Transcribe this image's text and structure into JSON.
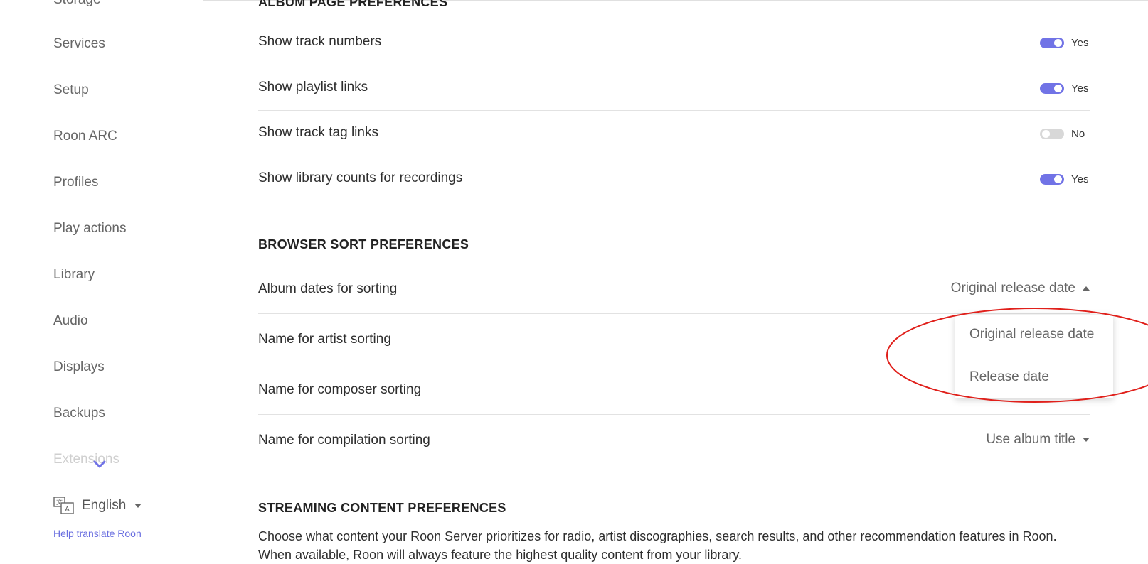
{
  "sidebar": {
    "items": [
      {
        "label": "Storage"
      },
      {
        "label": "Services"
      },
      {
        "label": "Setup"
      },
      {
        "label": "Roon ARC"
      },
      {
        "label": "Profiles"
      },
      {
        "label": "Play actions"
      },
      {
        "label": "Library"
      },
      {
        "label": "Audio"
      },
      {
        "label": "Displays"
      },
      {
        "label": "Backups"
      },
      {
        "label": "Extensions"
      }
    ],
    "language": "English",
    "help_link": "Help translate Roon"
  },
  "album_page": {
    "title": "ALBUM PAGE PREFERENCES",
    "rows": [
      {
        "label": "Show track numbers",
        "value": "Yes",
        "on": true
      },
      {
        "label": "Show playlist links",
        "value": "Yes",
        "on": true
      },
      {
        "label": "Show track tag links",
        "value": "No",
        "on": false
      },
      {
        "label": "Show library counts for recordings",
        "value": "Yes",
        "on": true
      }
    ]
  },
  "browser_sort": {
    "title": "BROWSER SORT PREFERENCES",
    "rows": [
      {
        "label": "Album dates for sorting",
        "value": "Original release date"
      },
      {
        "label": "Name for artist sorting"
      },
      {
        "label": "Name for composer sorting"
      },
      {
        "label": "Name for compilation sorting",
        "value": "Use album title"
      }
    ],
    "dropdown_options": [
      "Original release date",
      "Release date"
    ]
  },
  "streaming": {
    "title": "STREAMING CONTENT PREFERENCES",
    "description": "Choose what content your Roon Server prioritizes for radio, artist discographies, search results, and other recommendation features in Roon. When available, Roon will always feature the highest quality content from your library."
  },
  "colors": {
    "accent": "#7173e6",
    "annotation": "#e0201b"
  }
}
